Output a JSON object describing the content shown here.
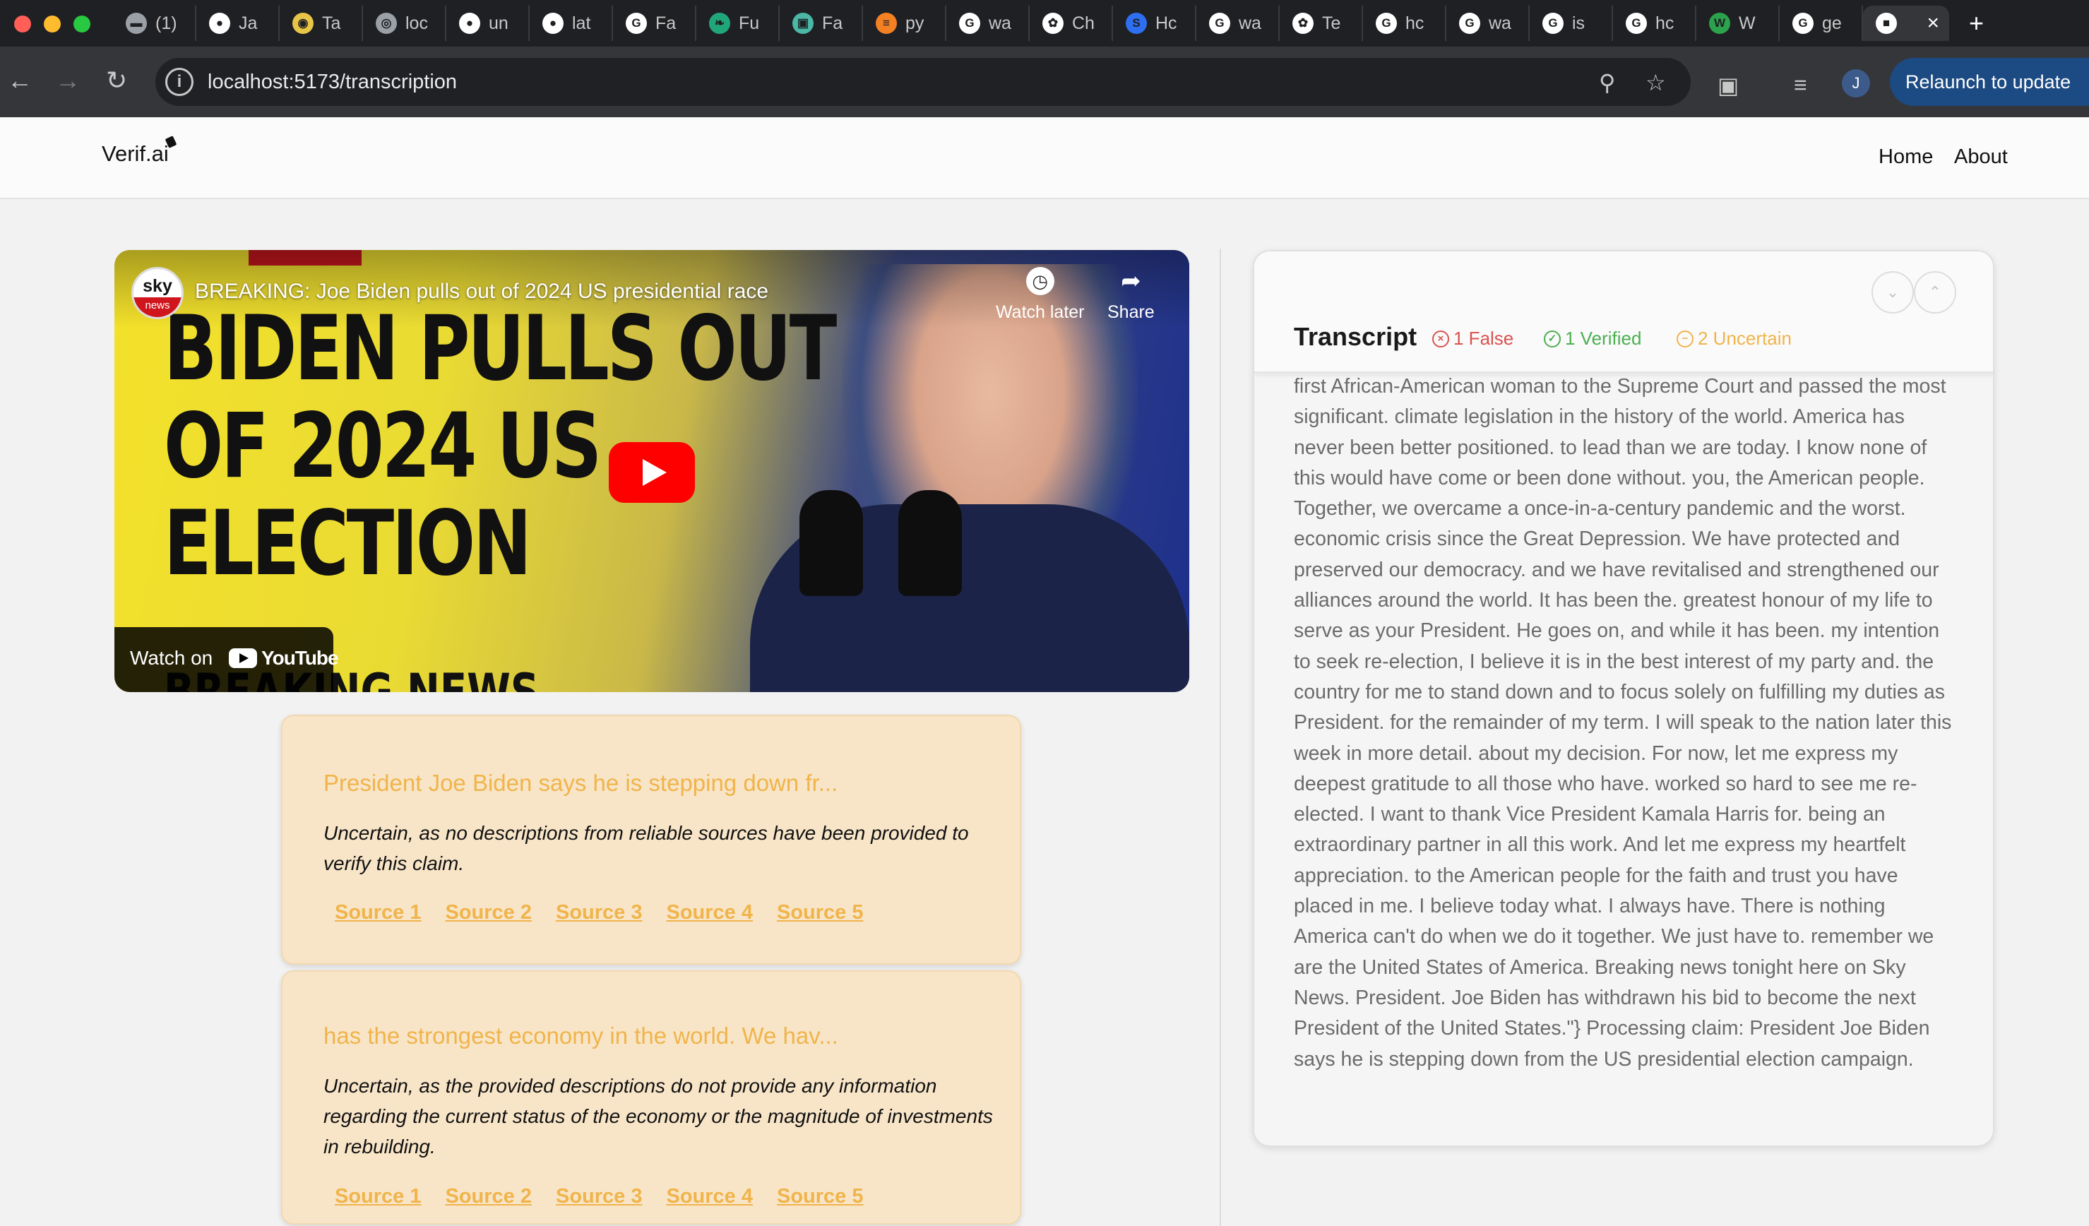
{
  "browser": {
    "tabs": [
      {
        "label": "(1)",
        "icon": "page-icon",
        "color": "#9aa0a6"
      },
      {
        "label": "Ja",
        "icon": "github-icon",
        "color": "#ffffff"
      },
      {
        "label": "Ta",
        "icon": "person-icon",
        "color": "#e8c547"
      },
      {
        "label": "loc",
        "icon": "globe-icon",
        "color": "#9aa0a6"
      },
      {
        "label": "un",
        "icon": "github-icon",
        "color": "#ffffff"
      },
      {
        "label": "lat",
        "icon": "github-icon",
        "color": "#ffffff"
      },
      {
        "label": "Fa",
        "icon": "google-icon",
        "color": "#ffffff"
      },
      {
        "label": "Fu",
        "icon": "leaf-icon",
        "color": "#21a67a"
      },
      {
        "label": "Fa",
        "icon": "site-icon",
        "color": "#4bb7a4"
      },
      {
        "label": "py",
        "icon": "stack-icon",
        "color": "#f48024"
      },
      {
        "label": "wa",
        "icon": "google-icon",
        "color": "#ffffff"
      },
      {
        "label": "Ch",
        "icon": "openai-icon",
        "color": "#ffffff"
      },
      {
        "label": "Hc",
        "icon": "s-icon",
        "color": "#2d6ff0"
      },
      {
        "label": "wa",
        "icon": "google-icon",
        "color": "#ffffff"
      },
      {
        "label": "Te",
        "icon": "openai-icon",
        "color": "#ffffff"
      },
      {
        "label": "hc",
        "icon": "google-icon",
        "color": "#ffffff"
      },
      {
        "label": "wa",
        "icon": "google-icon",
        "color": "#ffffff"
      },
      {
        "label": "is",
        "icon": "google-icon",
        "color": "#ffffff"
      },
      {
        "label": "hc",
        "icon": "google-icon",
        "color": "#ffffff"
      },
      {
        "label": "W",
        "icon": "w-icon",
        "color": "#2ca24c"
      },
      {
        "label": "ge",
        "icon": "google-icon",
        "color": "#ffffff"
      }
    ],
    "url": "localhost:5173/transcription",
    "profile_initial": "J",
    "relaunch_label": "Relaunch to update"
  },
  "app": {
    "logo": "Verif.ai",
    "nav": {
      "home": "Home",
      "about": "About"
    }
  },
  "video": {
    "channel": "sky",
    "channel_sub": "news",
    "title": "BREAKING: Joe Biden pulls out of 2024 US presidential race",
    "watch_later": "Watch later",
    "share": "Share",
    "headline_lines": [
      "BIDEN PULLS OUT",
      "OF 2024 US",
      "ELECTION"
    ],
    "bottom_text": "BREAKING NEWS",
    "watch_on": "Watch on",
    "youtube": "YouTube"
  },
  "claims": [
    {
      "title": "President Joe Biden says he is stepping down fr...",
      "text": "Uncertain, as no descriptions from reliable sources have been provided to verify this claim.",
      "sources": [
        "Source 1",
        "Source 2",
        "Source 3",
        "Source 4",
        "Source 5"
      ]
    },
    {
      "title": "has the strongest economy in the world. We hav...",
      "text": "Uncertain, as the provided descriptions do not provide any information regarding the current status of the economy or the magnitude of investments in rebuilding.",
      "sources": [
        "Source 1",
        "Source 2",
        "Source 3",
        "Source 4",
        "Source 5"
      ]
    }
  ],
  "transcript": {
    "title": "Transcript",
    "stats": [
      {
        "label": "1 False",
        "color": "#d9534f",
        "icon": "x-circle-icon"
      },
      {
        "label": "1 Verified",
        "color": "#4caf50",
        "icon": "check-circle-icon"
      },
      {
        "label": "2 Uncertain",
        "color": "#f0b44a",
        "icon": "minus-circle-icon"
      }
    ],
    "text": "first African-American woman to the Supreme Court and passed the most significant. climate legislation in the history of the world. America has never been better positioned. to lead than we are today. I know none of this would have come or been done without. you, the American people. Together, we overcame a once-in-a-century pandemic and the worst. economic crisis since the Great Depression. We have protected and preserved our democracy. and we have revitalised and strengthened our alliances around the world. It has been the. greatest honour of my life to serve as your President. He goes on, and while it has been. my intention to seek re-election, I believe it is in the best interest of my party and. the country for me to stand down and to focus solely on fulfilling my duties as President. for the remainder of my term. I will speak to the nation later this week in more detail. about my decision. For now, let me express my deepest gratitude to all those who have. worked so hard to see me re-elected. I want to thank Vice President Kamala Harris for. being an extraordinary partner in all this work. And let me express my heartfelt appreciation. to the American people for the faith and trust you have placed in me. I believe today what. I always have. There is nothing America can't do when we do it together. We just have to. remember we are the United States of America. Breaking news tonight here on Sky News. President. Joe Biden has withdrawn his bid to become the next President of the United States.\"} Processing claim: President Joe Biden says he is stepping down from the US presidential election campaign."
  }
}
